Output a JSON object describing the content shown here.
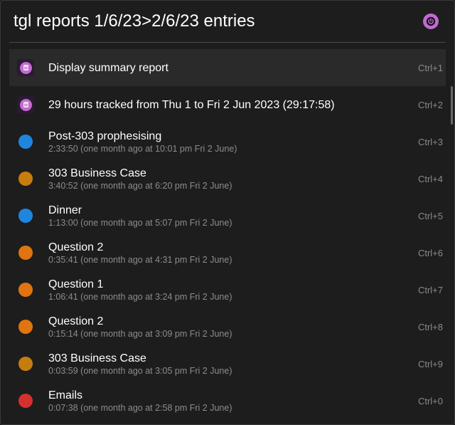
{
  "search": {
    "query": "tgl reports 1/6/23>2/6/23 entries"
  },
  "colors": {
    "accent": "#c26ccf",
    "blue": "#1f86e0",
    "amber": "#c67d0e",
    "orange": "#e07410",
    "red": "#d43030"
  },
  "results": [
    {
      "icon": "report-icon",
      "title": "Display summary report",
      "subtitle": "",
      "shortcut": "Ctrl+1"
    },
    {
      "icon": "report-icon",
      "title": "29 hours tracked from Thu 1 to Fri 2 Jun 2023 (29:17:58)",
      "subtitle": "",
      "shortcut": "Ctrl+2"
    },
    {
      "icon": "blue-dot-icon",
      "color": "#1f86e0",
      "title": "Post-303 prophesising",
      "subtitle": "2:33:50 (one month ago at 10:01 pm Fri 2 June)",
      "shortcut": "Ctrl+3"
    },
    {
      "icon": "amber-dot-icon",
      "color": "#c67d0e",
      "title": "303 Business Case",
      "subtitle": "3:40:52 (one month ago at 6:20 pm Fri 2 June)",
      "shortcut": "Ctrl+4"
    },
    {
      "icon": "blue-dot-icon",
      "color": "#1f86e0",
      "title": "Dinner",
      "subtitle": "1:13:00 (one month ago at 5:07 pm Fri 2 June)",
      "shortcut": "Ctrl+5"
    },
    {
      "icon": "orange-dot-icon",
      "color": "#e07410",
      "title": "Question 2",
      "subtitle": "0:35:41 (one month ago at 4:31 pm Fri 2 June)",
      "shortcut": "Ctrl+6"
    },
    {
      "icon": "orange-dot-icon",
      "color": "#e07410",
      "title": "Question 1",
      "subtitle": "1:06:41 (one month ago at 3:24 pm Fri 2 June)",
      "shortcut": "Ctrl+7"
    },
    {
      "icon": "orange-dot-icon",
      "color": "#e07410",
      "title": "Question 2",
      "subtitle": "0:15:14 (one month ago at 3:09 pm Fri 2 June)",
      "shortcut": "Ctrl+8"
    },
    {
      "icon": "amber-dot-icon",
      "color": "#c67d0e",
      "title": "303 Business Case",
      "subtitle": "0:03:59 (one month ago at 3:05 pm Fri 2 June)",
      "shortcut": "Ctrl+9"
    },
    {
      "icon": "red-dot-icon",
      "color": "#d43030",
      "title": "Emails",
      "subtitle": "0:07:38 (one month ago at 2:58 pm Fri 2 June)",
      "shortcut": "Ctrl+0"
    }
  ]
}
